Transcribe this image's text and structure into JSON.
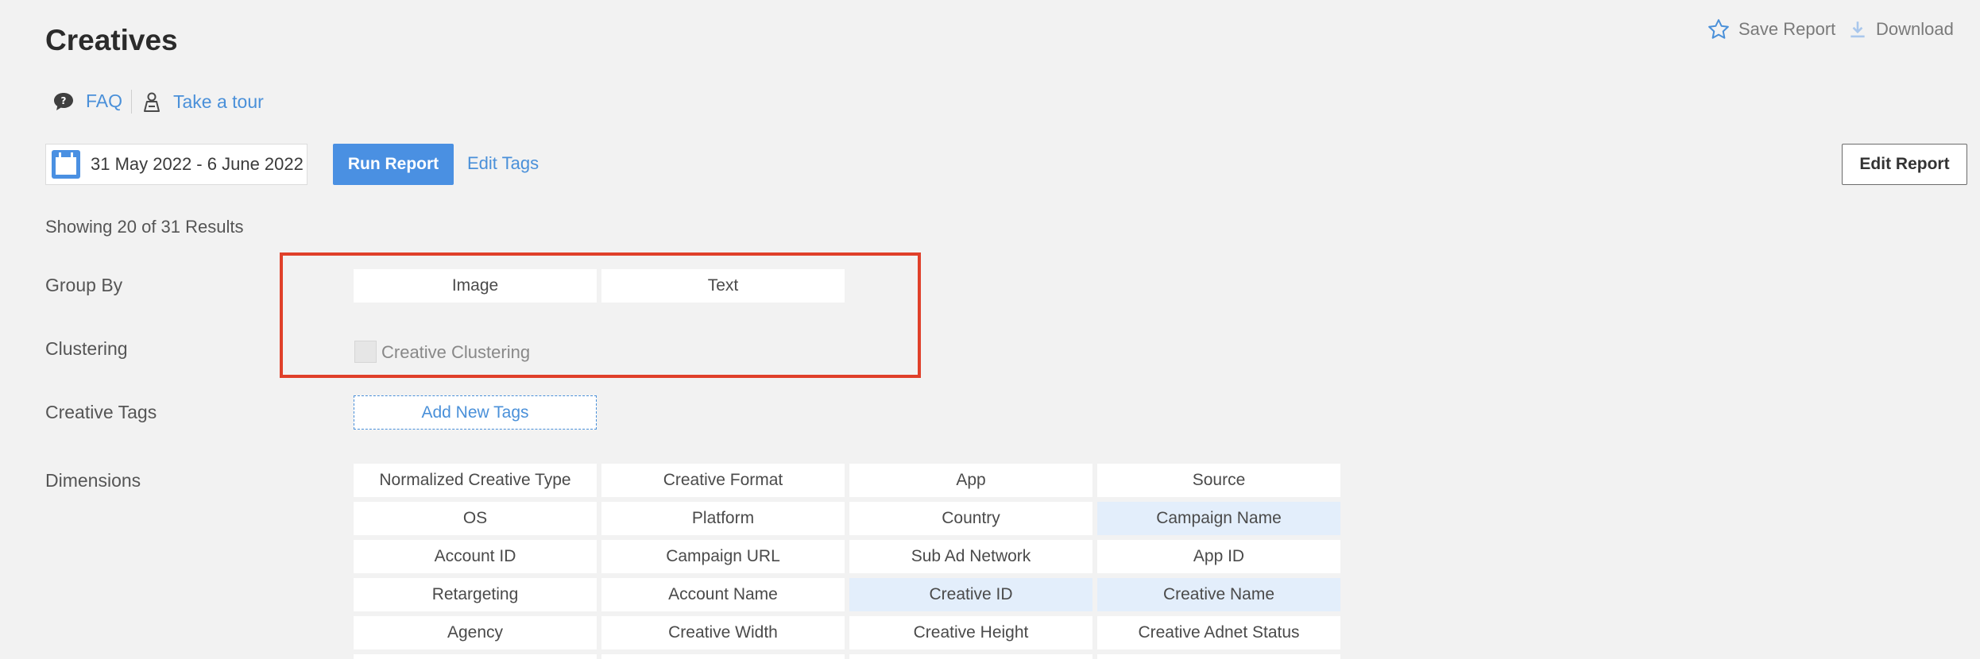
{
  "page": {
    "title": "Creatives"
  },
  "header_actions": {
    "save_report": "Save Report",
    "download": "Download"
  },
  "help": {
    "faq": "FAQ",
    "tour": "Take a tour"
  },
  "toolbar": {
    "date_range": "31 May 2022 - 6 June 2022",
    "run_report": "Run Report",
    "edit_tags": "Edit Tags",
    "edit_report": "Edit Report"
  },
  "results": {
    "summary": "Showing 20 of 31 Results"
  },
  "group_by": {
    "label": "Group By",
    "options": [
      "Image",
      "Text"
    ]
  },
  "clustering": {
    "label": "Clustering",
    "option_label": "Creative Clustering",
    "checked": false
  },
  "creative_tags": {
    "label": "Creative Tags",
    "add_button": "Add New Tags"
  },
  "dimensions": {
    "label": "Dimensions",
    "rows": [
      [
        "Normalized Creative Type",
        "Creative Format",
        "App",
        "Source"
      ],
      [
        "OS",
        "Platform",
        "Country",
        "Campaign Name"
      ],
      [
        "Account ID",
        "Campaign URL",
        "Sub Ad Network",
        "App ID"
      ],
      [
        "Retargeting",
        "Account Name",
        "Creative ID",
        "Creative Name"
      ],
      [
        "Agency",
        "Creative Width",
        "Creative Height",
        "Creative Adnet Status"
      ]
    ],
    "selected": [
      "Campaign Name",
      "Creative ID",
      "Creative Name"
    ]
  },
  "colors": {
    "accent": "#4a90e2",
    "highlight": "#e3eefb",
    "annotation_box": "#e0402a"
  }
}
